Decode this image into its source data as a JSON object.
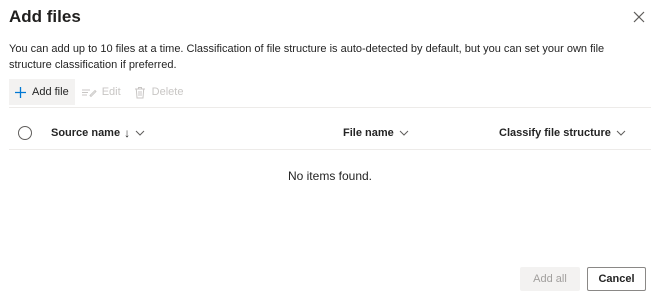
{
  "dialog": {
    "title": "Add files",
    "description": "You can add up to 10 files at a time. Classification of file structure is auto-detected by default, but you can set your own file structure classification if preferred."
  },
  "toolbar": {
    "add_file": "Add file",
    "edit": "Edit",
    "delete": "Delete"
  },
  "table": {
    "columns": {
      "source_name": "Source name",
      "sort_indicator": "↓",
      "file_name": "File name",
      "classify": "Classify file structure"
    },
    "empty_text": "No items found.",
    "rows": []
  },
  "footer": {
    "add_all": "Add all",
    "cancel": "Cancel"
  },
  "colors": {
    "accent": "#0078d4",
    "disabled_text": "#c8c6c4",
    "divider": "#edebe9"
  }
}
